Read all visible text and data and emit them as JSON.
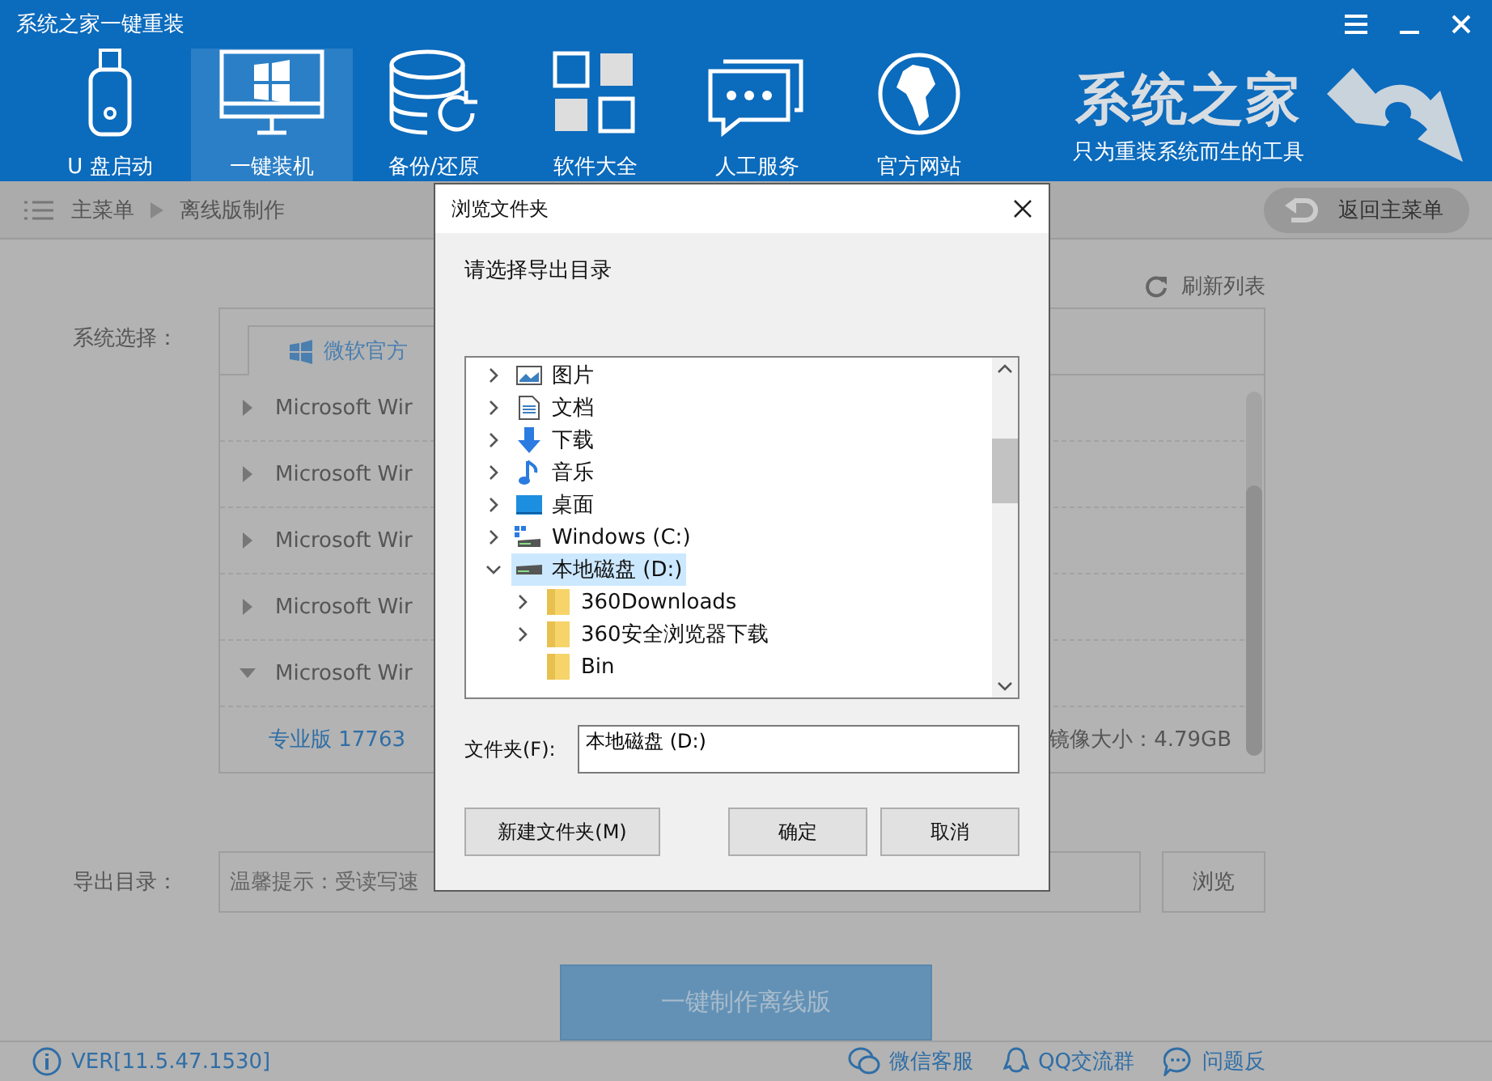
{
  "window": {
    "title": "系统之家一键重装"
  },
  "nav": [
    {
      "label": "U 盘启动",
      "selected": false
    },
    {
      "label": "一键装机",
      "selected": true
    },
    {
      "label": "备份/还原",
      "selected": false
    },
    {
      "label": "软件大全",
      "selected": false
    },
    {
      "label": "人工服务",
      "selected": false
    },
    {
      "label": "官方网站",
      "selected": false
    }
  ],
  "brand": {
    "name": "系统之家",
    "slogan": "只为重装系统而生的工具"
  },
  "breadcrumb": [
    "主菜单",
    "离线版制作"
  ],
  "back_button": "返回主菜单",
  "refresh": "刷新列表",
  "system_label": "系统选择：",
  "source_tab": "微软官方",
  "os_list": [
    {
      "name": "Microsoft Wir",
      "expanded": false
    },
    {
      "name": "Microsoft Wir",
      "expanded": false
    },
    {
      "name": "Microsoft Wir",
      "expanded": false
    },
    {
      "name": "Microsoft Wir",
      "expanded": false
    },
    {
      "name": "Microsoft Wir",
      "expanded": true
    }
  ],
  "edition": {
    "name": "专业版 17763",
    "size": "镜像大小：4.79GB"
  },
  "export": {
    "label": "导出目录：",
    "placeholder": "温馨提示：受读写速",
    "browse": "浏览"
  },
  "make_button": "一键制作离线版",
  "footer": {
    "version": "VER[11.5.47.1530]",
    "links": [
      {
        "label": "微信客服"
      },
      {
        "label": "QQ交流群"
      },
      {
        "label": "问题反"
      }
    ]
  },
  "dialog": {
    "title": "浏览文件夹",
    "prompt": "请选择导出目录",
    "tree": [
      {
        "label": "图片",
        "kind": "pictures",
        "has_children": true,
        "selected": false
      },
      {
        "label": "文档",
        "kind": "documents",
        "has_children": true,
        "selected": false
      },
      {
        "label": "下载",
        "kind": "download",
        "has_children": true,
        "selected": false
      },
      {
        "label": "音乐",
        "kind": "music",
        "has_children": true,
        "selected": false
      },
      {
        "label": "桌面",
        "kind": "desktop",
        "has_children": true,
        "selected": false
      },
      {
        "label": "Windows (C:)",
        "kind": "system-drive",
        "has_children": true,
        "selected": false
      },
      {
        "label": "本地磁盘 (D:)",
        "kind": "drive",
        "has_children": true,
        "expanded": true,
        "selected": true,
        "children": [
          {
            "label": "360Downloads",
            "kind": "folder",
            "has_children": true,
            "selected": false
          },
          {
            "label": "360安全浏览器下载",
            "kind": "folder",
            "has_children": true,
            "selected": false
          },
          {
            "label": "Bin",
            "kind": "folder",
            "has_children": false,
            "selected": false
          }
        ]
      }
    ],
    "folder_label": "文件夹(F):",
    "folder_value": "本地磁盘 (D:)",
    "buttons": {
      "new_folder": "新建文件夹(M)",
      "ok": "确定",
      "cancel": "取消"
    }
  }
}
